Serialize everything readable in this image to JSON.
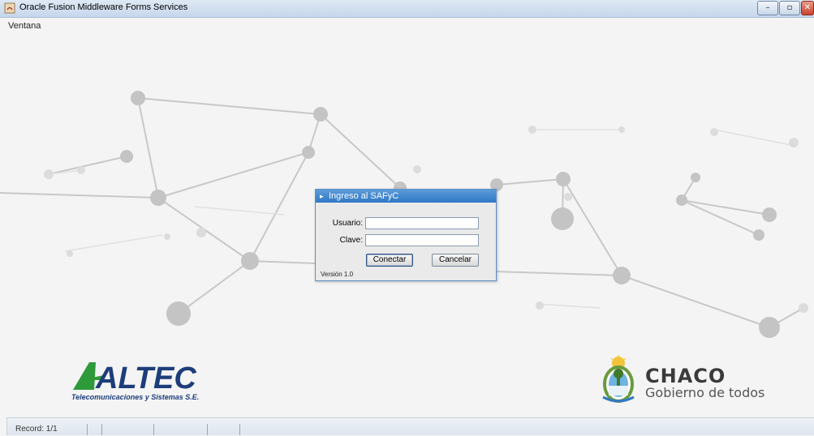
{
  "window": {
    "title": "Oracle Fusion Middleware Forms Services",
    "controls": [
      "minimize-icon",
      "maximize-icon",
      "close-icon"
    ]
  },
  "menubar": {
    "items": [
      {
        "label": "Ventana"
      }
    ]
  },
  "dialog": {
    "title": "Ingreso al SAFyC",
    "usuario_label": "Usuario:",
    "usuario_value": "",
    "clave_label": "Clave:",
    "clave_value": "",
    "connect_label": "Conectar",
    "cancel_label": "Cancelar",
    "version": "Versión 1.0"
  },
  "logos": {
    "altec_name": "ALTEC",
    "altec_sub": "Telecomunicaciones y Sistemas S.E.",
    "chaco_name": "CHACO",
    "chaco_sub": "Gobierno de todos"
  },
  "statusbar": {
    "record": "Record: 1/1"
  },
  "colors": {
    "dialog_title": "#3a86cf",
    "altec_green": "#2e9a3a",
    "altec_blue": "#1d3d7a",
    "background": "#f4f4f4"
  }
}
